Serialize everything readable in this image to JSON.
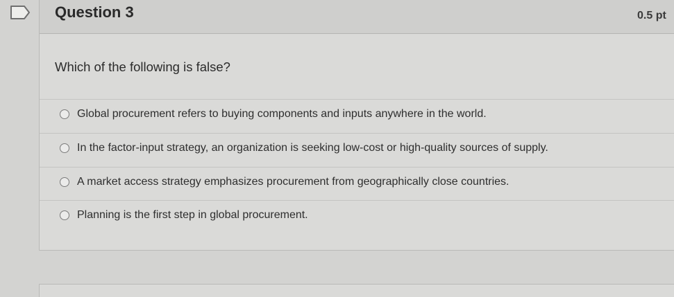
{
  "question": {
    "title": "Question 3",
    "points": "0.5 pt",
    "prompt": "Which of the following is false?",
    "answers": [
      {
        "label": "Global procurement refers to buying components and inputs anywhere in the world."
      },
      {
        "label": "In the factor-input strategy, an organization is seeking low-cost or high-quality sources of supply."
      },
      {
        "label": "A market access strategy emphasizes procurement from geographically close countries."
      },
      {
        "label": "Planning is the first step in global procurement."
      }
    ]
  },
  "icons": {
    "bookmark": "bookmark-flag-icon",
    "radio": "radio-unselected-icon"
  },
  "colors": {
    "background": "#d3d3d1",
    "card": "#dadad8",
    "header": "#cfcfcd",
    "text": "#2b2b2b"
  }
}
